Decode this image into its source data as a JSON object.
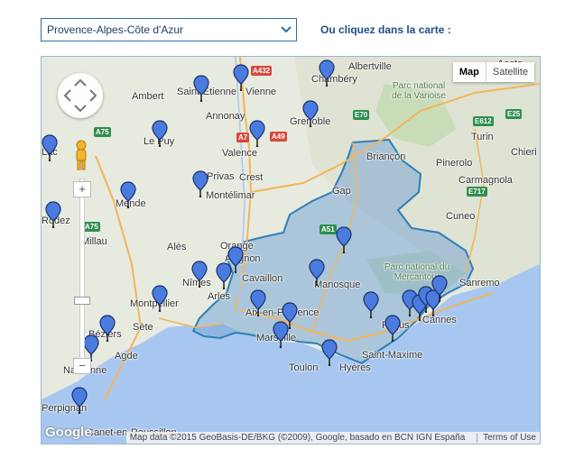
{
  "region_select": {
    "value": "Provence-Alpes-Côte d'Azur",
    "icon": "chevron-down-icon"
  },
  "prompt_text": "Ou cliquez dans la carte :",
  "map": {
    "type_buttons": [
      "Map",
      "Satellite"
    ],
    "active_type": "Map",
    "zoom_in": "+",
    "zoom_out": "−",
    "google_logo": "Google",
    "attribution": "Map data ©2015 GeoBasis-DE/BKG (©2009), Google, basado en BCN IGN España",
    "terms": "Terms of Use",
    "colors": {
      "sea": "#a8c7f0",
      "land": "#e7eadf",
      "region_fill": "#7aa8d6",
      "region_stroke": "#2f7fb8",
      "pin": "#4a7ce0"
    },
    "cities": [
      {
        "name": "Saint-Étienne"
      },
      {
        "name": "Vienne"
      },
      {
        "name": "Chambéry"
      },
      {
        "name": "Albertville"
      },
      {
        "name": "Ambert"
      },
      {
        "name": "Annonay"
      },
      {
        "name": "Grenoble"
      },
      {
        "name": "Le Puy"
      },
      {
        "name": "Valence"
      },
      {
        "name": "Crest"
      },
      {
        "name": "Privas"
      },
      {
        "name": "Montélimar"
      },
      {
        "name": "Mende"
      },
      {
        "name": "Rodez"
      },
      {
        "name": "Millau"
      },
      {
        "name": "Alès"
      },
      {
        "name": "Orange"
      },
      {
        "name": "Avignon"
      },
      {
        "name": "Nîmes"
      },
      {
        "name": "Arles"
      },
      {
        "name": "Montpellier"
      },
      {
        "name": "Sète"
      },
      {
        "name": "Agde"
      },
      {
        "name": "Béziers"
      },
      {
        "name": "Narbonne"
      },
      {
        "name": "Perpignan"
      },
      {
        "name": "Canet-en-Roussillon"
      },
      {
        "name": "Cavaillon"
      },
      {
        "name": "Manosque"
      },
      {
        "name": "Aix-en-Provence"
      },
      {
        "name": "Marseille"
      },
      {
        "name": "Toulon"
      },
      {
        "name": "Hyères"
      },
      {
        "name": "Saint-Maxime"
      },
      {
        "name": "Fréjus"
      },
      {
        "name": "Cannes"
      },
      {
        "name": "Sanremo"
      },
      {
        "name": "Gap"
      },
      {
        "name": "Briançon"
      },
      {
        "name": "Turin"
      },
      {
        "name": "Pinerolo"
      },
      {
        "name": "Carmagnola"
      },
      {
        "name": "Cuneo"
      },
      {
        "name": "Chieri"
      },
      {
        "name": "Aosta"
      },
      {
        "name": "Lac"
      }
    ],
    "parks": [
      {
        "name": "Parc national de la Vanoise"
      },
      {
        "name": "Parc national du Mercantour"
      }
    ],
    "roads": [
      {
        "ref": "A432",
        "color": "red"
      },
      {
        "ref": "A7",
        "color": "red"
      },
      {
        "ref": "A49",
        "color": "red"
      },
      {
        "ref": "A75",
        "color": "green"
      },
      {
        "ref": "A75",
        "color": "green"
      },
      {
        "ref": "A51",
        "color": "green"
      },
      {
        "ref": "E70",
        "color": "green"
      },
      {
        "ref": "E612",
        "color": "green"
      },
      {
        "ref": "E25",
        "color": "green"
      },
      {
        "ref": "E717",
        "color": "green"
      }
    ]
  }
}
